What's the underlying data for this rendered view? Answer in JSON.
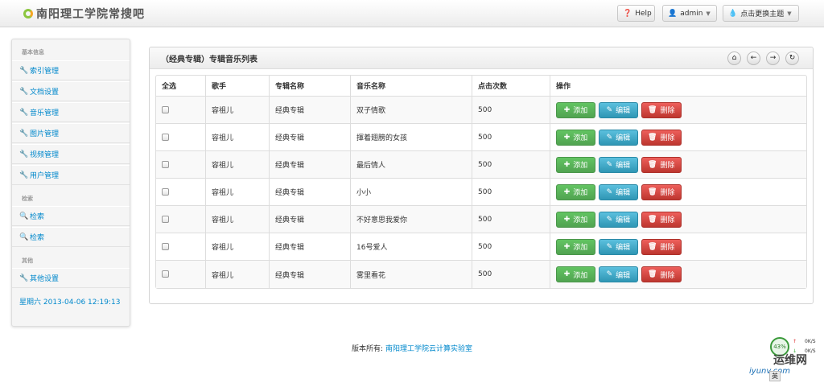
{
  "brand": {
    "title": "南阳理工学院常搜吧"
  },
  "topnav": {
    "help": "Help",
    "user": "admin",
    "theme": "点击更换主题"
  },
  "sidebar": {
    "sections": [
      {
        "header": "基本信息",
        "items": [
          "索引管理",
          "文档设置",
          "音乐管理",
          "图片管理",
          "视频管理",
          "用户管理"
        ]
      },
      {
        "header": "检索",
        "items": [
          "检索",
          "检索"
        ]
      },
      {
        "header": "其他",
        "items": [
          "其他设置"
        ]
      }
    ],
    "datetime": "星期六 2013-04-06 12:19:13"
  },
  "panel": {
    "title": "（经典专辑）专辑音乐列表"
  },
  "table": {
    "headers": [
      "全选",
      "歌手",
      "专辑名称",
      "音乐名称",
      "点击次数",
      "操作"
    ],
    "rows": [
      {
        "singer": "容祖儿",
        "album": "经典专辑",
        "song": "双子情歌",
        "clicks": "500"
      },
      {
        "singer": "容祖儿",
        "album": "经典专辑",
        "song": "揮着翅膀的女孩",
        "clicks": "500"
      },
      {
        "singer": "容祖儿",
        "album": "经典专辑",
        "song": "最后情人",
        "clicks": "500"
      },
      {
        "singer": "容祖儿",
        "album": "经典专辑",
        "song": "小小",
        "clicks": "500"
      },
      {
        "singer": "容祖儿",
        "album": "经典专辑",
        "song": "不好意思我爱你",
        "clicks": "500"
      },
      {
        "singer": "容祖儿",
        "album": "经典专辑",
        "song": "16号爱人",
        "clicks": "500"
      },
      {
        "singer": "容祖儿",
        "album": "经典专辑",
        "song": "雾里看花",
        "clicks": "500"
      }
    ],
    "actions": {
      "add": "添加",
      "edit": "编辑",
      "delete": "删除"
    }
  },
  "footer": {
    "prefix": "版本所有:",
    "link": "南阳理工学院云计算实验室"
  },
  "widget": {
    "percent": "43%",
    "up": "0K/S",
    "down": "0K/S",
    "logo": "运维网",
    "url": "iyunv.com",
    "ime": "英"
  },
  "colors": {
    "link": "#0088cc",
    "add": "#51a351",
    "edit": "#2f96b4",
    "delete": "#bd362f"
  }
}
